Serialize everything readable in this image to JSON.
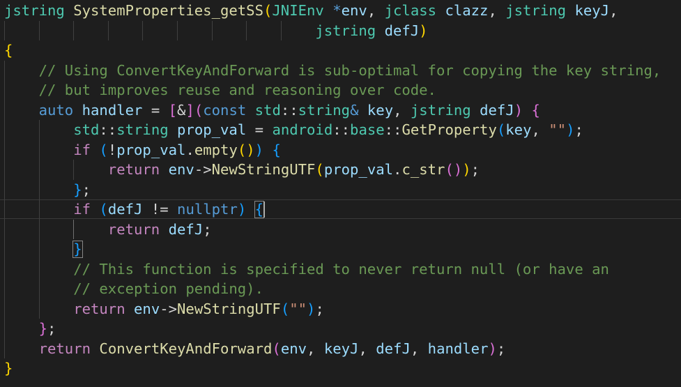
{
  "editor": {
    "language": "cpp",
    "theme_colors": {
      "background": "#1e1e1e",
      "type": "#4ec9b0",
      "function": "#dcdcaa",
      "variable": "#9cdcfe",
      "keyword": "#569cd6",
      "control": "#c586c0",
      "comment": "#6a9955",
      "string": "#ce9178",
      "bracket_level_1": "#ffd700",
      "bracket_level_2": "#da70d6",
      "bracket_level_3": "#179fff"
    },
    "lines": [
      [
        [
          "type",
          "jstring"
        ],
        [
          "punc",
          " "
        ],
        [
          "fn",
          "SystemProperties_getSS"
        ],
        [
          "b1",
          "("
        ],
        [
          "type",
          "JNIEnv"
        ],
        [
          "punc",
          " "
        ],
        [
          "kw",
          "*"
        ],
        [
          "var",
          "env"
        ],
        [
          "punc",
          ", "
        ],
        [
          "type",
          "jclass"
        ],
        [
          "punc",
          " "
        ],
        [
          "var",
          "clazz"
        ],
        [
          "punc",
          ", "
        ],
        [
          "type",
          "jstring"
        ],
        [
          "punc",
          " "
        ],
        [
          "var",
          "keyJ"
        ],
        [
          "punc",
          ","
        ]
      ],
      [
        [
          "punc",
          "                                    "
        ],
        [
          "type",
          "jstring"
        ],
        [
          "punc",
          " "
        ],
        [
          "var",
          "defJ"
        ],
        [
          "b1",
          ")"
        ]
      ],
      [
        [
          "b1",
          "{"
        ]
      ],
      [
        [
          "punc",
          "    "
        ],
        [
          "cmt",
          "// Using ConvertKeyAndForward is sub-optimal for copying the key string,"
        ]
      ],
      [
        [
          "punc",
          "    "
        ],
        [
          "cmt",
          "// but improves reuse and reasoning over code."
        ]
      ],
      [
        [
          "punc",
          "    "
        ],
        [
          "kw",
          "auto"
        ],
        [
          "punc",
          " "
        ],
        [
          "var",
          "handler"
        ],
        [
          "punc",
          " = "
        ],
        [
          "b2",
          "["
        ],
        [
          "punc",
          "&"
        ],
        [
          "b2",
          "]"
        ],
        [
          "b2",
          "("
        ],
        [
          "kw",
          "const"
        ],
        [
          "punc",
          " "
        ],
        [
          "type",
          "std"
        ],
        [
          "punc",
          "::"
        ],
        [
          "type",
          "string"
        ],
        [
          "kw",
          "&"
        ],
        [
          "punc",
          " "
        ],
        [
          "var",
          "key"
        ],
        [
          "punc",
          ", "
        ],
        [
          "type",
          "jstring"
        ],
        [
          "punc",
          " "
        ],
        [
          "var",
          "defJ"
        ],
        [
          "b2",
          ")"
        ],
        [
          "punc",
          " "
        ],
        [
          "b2",
          "{"
        ]
      ],
      [
        [
          "punc",
          "        "
        ],
        [
          "type",
          "std"
        ],
        [
          "punc",
          "::"
        ],
        [
          "type",
          "string"
        ],
        [
          "punc",
          " "
        ],
        [
          "var",
          "prop_val"
        ],
        [
          "punc",
          " = "
        ],
        [
          "type",
          "android"
        ],
        [
          "punc",
          "::"
        ],
        [
          "type",
          "base"
        ],
        [
          "punc",
          "::"
        ],
        [
          "fn",
          "GetProperty"
        ],
        [
          "b3",
          "("
        ],
        [
          "var",
          "key"
        ],
        [
          "punc",
          ", "
        ],
        [
          "str",
          "\"\""
        ],
        [
          "b3",
          ")"
        ],
        [
          "punc",
          ";"
        ]
      ],
      [
        [
          "punc",
          "        "
        ],
        [
          "ctl",
          "if"
        ],
        [
          "punc",
          " "
        ],
        [
          "b3",
          "("
        ],
        [
          "punc",
          "!"
        ],
        [
          "var",
          "prop_val"
        ],
        [
          "punc",
          "."
        ],
        [
          "fn",
          "empty"
        ],
        [
          "b1",
          "()"
        ],
        [
          "b3",
          ")"
        ],
        [
          "punc",
          " "
        ],
        [
          "b3",
          "{"
        ]
      ],
      [
        [
          "punc",
          "            "
        ],
        [
          "ctl",
          "return"
        ],
        [
          "punc",
          " "
        ],
        [
          "var",
          "env"
        ],
        [
          "punc",
          "->"
        ],
        [
          "fn",
          "NewStringUTF"
        ],
        [
          "b1",
          "("
        ],
        [
          "var",
          "prop_val"
        ],
        [
          "punc",
          "."
        ],
        [
          "fn",
          "c_str"
        ],
        [
          "b2",
          "()"
        ],
        [
          "b1",
          ")"
        ],
        [
          "punc",
          ";"
        ]
      ],
      [
        [
          "punc",
          "        "
        ],
        [
          "b3",
          "}"
        ],
        [
          "punc",
          ";"
        ]
      ],
      [
        [
          "punc",
          "        "
        ],
        [
          "ctl",
          "if"
        ],
        [
          "punc",
          " "
        ],
        [
          "b3",
          "("
        ],
        [
          "var",
          "defJ"
        ],
        [
          "punc",
          " != "
        ],
        [
          "kw",
          "nullptr"
        ],
        [
          "b3",
          ")"
        ],
        [
          "punc",
          " "
        ],
        [
          "b3",
          "{"
        ]
      ],
      [
        [
          "punc",
          "            "
        ],
        [
          "ctl",
          "return"
        ],
        [
          "punc",
          " "
        ],
        [
          "var",
          "defJ"
        ],
        [
          "punc",
          ";"
        ]
      ],
      [
        [
          "punc",
          "        "
        ],
        [
          "b3",
          "}"
        ]
      ],
      [
        [
          "punc",
          "        "
        ],
        [
          "cmt",
          "// This function is specified to never return null (or have an"
        ]
      ],
      [
        [
          "punc",
          "        "
        ],
        [
          "cmt",
          "// exception pending)."
        ]
      ],
      [
        [
          "punc",
          "        "
        ],
        [
          "ctl",
          "return"
        ],
        [
          "punc",
          " "
        ],
        [
          "var",
          "env"
        ],
        [
          "punc",
          "->"
        ],
        [
          "fn",
          "NewStringUTF"
        ],
        [
          "b3",
          "("
        ],
        [
          "str",
          "\"\""
        ],
        [
          "b3",
          ")"
        ],
        [
          "punc",
          ";"
        ]
      ],
      [
        [
          "punc",
          "    "
        ],
        [
          "b2",
          "}"
        ],
        [
          "punc",
          ";"
        ]
      ],
      [
        [
          "punc",
          "    "
        ],
        [
          "ctl",
          "return"
        ],
        [
          "punc",
          " "
        ],
        [
          "fn",
          "ConvertKeyAndForward"
        ],
        [
          "b2",
          "("
        ],
        [
          "var",
          "env"
        ],
        [
          "punc",
          ", "
        ],
        [
          "var",
          "keyJ"
        ],
        [
          "punc",
          ", "
        ],
        [
          "var",
          "defJ"
        ],
        [
          "punc",
          ", "
        ],
        [
          "var",
          "handler"
        ],
        [
          "b2",
          ")"
        ],
        [
          "punc",
          ";"
        ]
      ],
      [
        [
          "b1",
          "}"
        ]
      ]
    ]
  }
}
